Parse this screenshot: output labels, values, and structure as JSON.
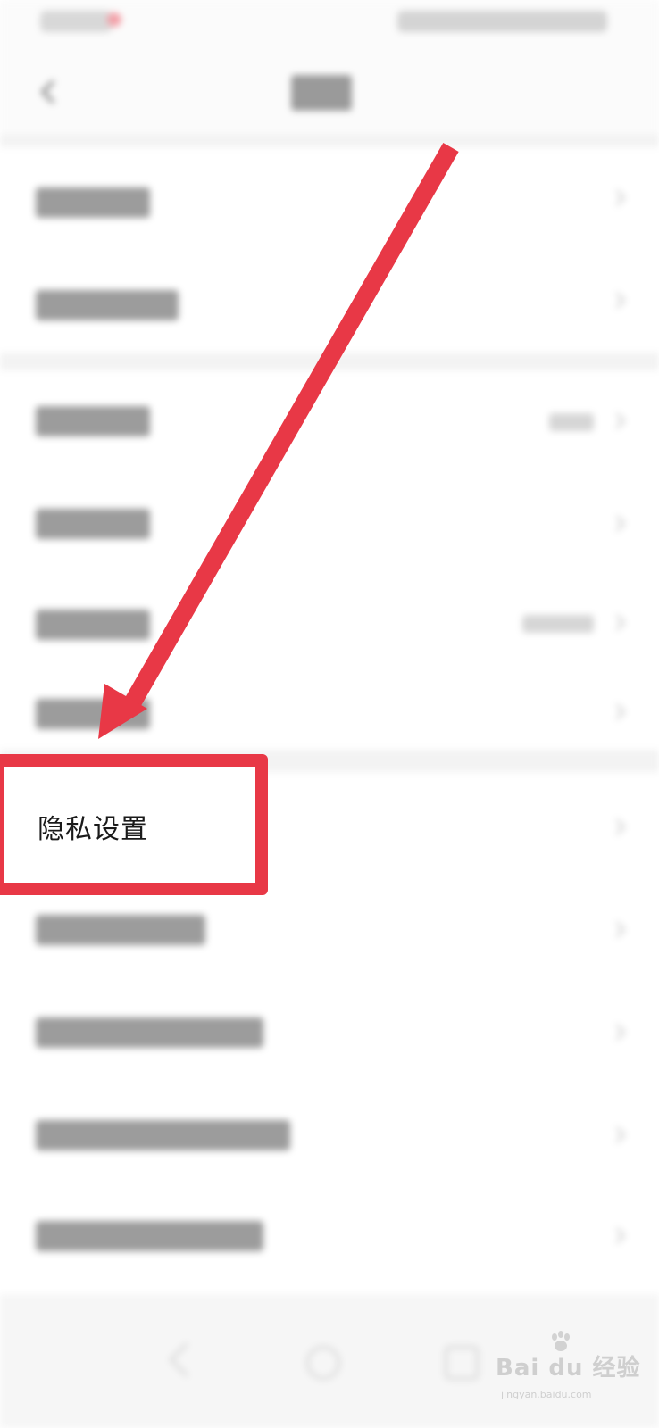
{
  "screen": {
    "highlighted_item_label": "隐私设置"
  },
  "colors": {
    "annotation_red": "#e83846",
    "background": "#ffffff",
    "section_gap": "#f3f3f3"
  },
  "watermark": {
    "brand": "Bai du 经验",
    "url": "jingyan.baidu.com"
  },
  "icons": {
    "back": "back-chevron-icon",
    "row_chevron": "chevron-right-icon",
    "annotation_arrow": "arrow-icon",
    "baidu_paw": "baidu-paw-icon"
  }
}
